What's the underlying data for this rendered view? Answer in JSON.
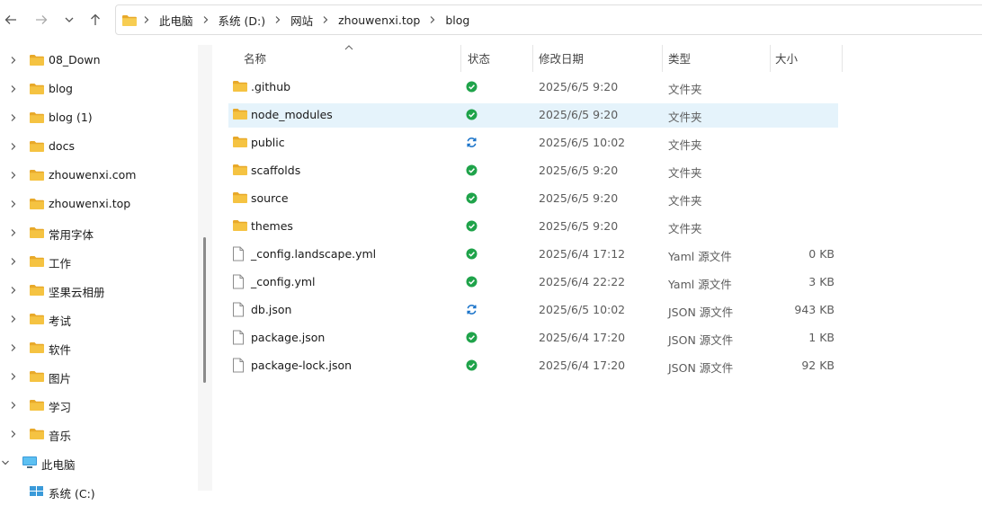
{
  "nav": {
    "back_icon": "arrow-left-icon",
    "forward_icon": "arrow-right-icon",
    "recent_icon": "chevron-down-icon",
    "up_icon": "arrow-up-icon"
  },
  "address": {
    "crumbs": [
      "此电脑",
      "系统 (D:)",
      "网站",
      "zhouwenxi.top",
      "blog"
    ]
  },
  "sidebar": {
    "items": [
      {
        "label": "08_Down"
      },
      {
        "label": "blog"
      },
      {
        "label": "blog (1)"
      },
      {
        "label": "docs"
      },
      {
        "label": "zhouwenxi.com"
      },
      {
        "label": "zhouwenxi.top"
      },
      {
        "label": "常用字体"
      },
      {
        "label": "工作"
      },
      {
        "label": "坚果云相册"
      },
      {
        "label": "考试"
      },
      {
        "label": "软件"
      },
      {
        "label": "图片"
      },
      {
        "label": "学习"
      },
      {
        "label": "音乐"
      }
    ],
    "this_pc": "此电脑",
    "drive": "系统 (C:)"
  },
  "columns": {
    "name": "名称",
    "status": "状态",
    "date": "修改日期",
    "type": "类型",
    "size": "大小"
  },
  "files": [
    {
      "name": ".github",
      "kind": "folder",
      "status": "synced",
      "date": "2025/6/5 9:20",
      "type": "文件夹",
      "size": ""
    },
    {
      "name": "node_modules",
      "kind": "folder",
      "status": "synced",
      "date": "2025/6/5 9:20",
      "type": "文件夹",
      "size": "",
      "selected": true
    },
    {
      "name": "public",
      "kind": "folder",
      "status": "syncing",
      "date": "2025/6/5 10:02",
      "type": "文件夹",
      "size": ""
    },
    {
      "name": "scaffolds",
      "kind": "folder",
      "status": "synced",
      "date": "2025/6/5 9:20",
      "type": "文件夹",
      "size": ""
    },
    {
      "name": "source",
      "kind": "folder",
      "status": "synced",
      "date": "2025/6/5 9:20",
      "type": "文件夹",
      "size": ""
    },
    {
      "name": "themes",
      "kind": "folder",
      "status": "synced",
      "date": "2025/6/5 9:20",
      "type": "文件夹",
      "size": ""
    },
    {
      "name": "_config.landscape.yml",
      "kind": "file",
      "status": "synced",
      "date": "2025/6/4 17:12",
      "type": "Yaml 源文件",
      "size": "0 KB"
    },
    {
      "name": "_config.yml",
      "kind": "file",
      "status": "synced",
      "date": "2025/6/4 22:22",
      "type": "Yaml 源文件",
      "size": "3 KB"
    },
    {
      "name": "db.json",
      "kind": "file",
      "status": "syncing",
      "date": "2025/6/5 10:02",
      "type": "JSON 源文件",
      "size": "943 KB"
    },
    {
      "name": "package.json",
      "kind": "file",
      "status": "synced",
      "date": "2025/6/4 17:20",
      "type": "JSON 源文件",
      "size": "1 KB"
    },
    {
      "name": "package-lock.json",
      "kind": "file",
      "status": "synced",
      "date": "2025/6/4 17:20",
      "type": "JSON 源文件",
      "size": "92 KB"
    }
  ],
  "colors": {
    "folder": "#f5c342",
    "folder_dark": "#e8a92a",
    "synced": "#1fa34a",
    "syncing": "#1a73c9",
    "selected": "#e5f3fb"
  }
}
